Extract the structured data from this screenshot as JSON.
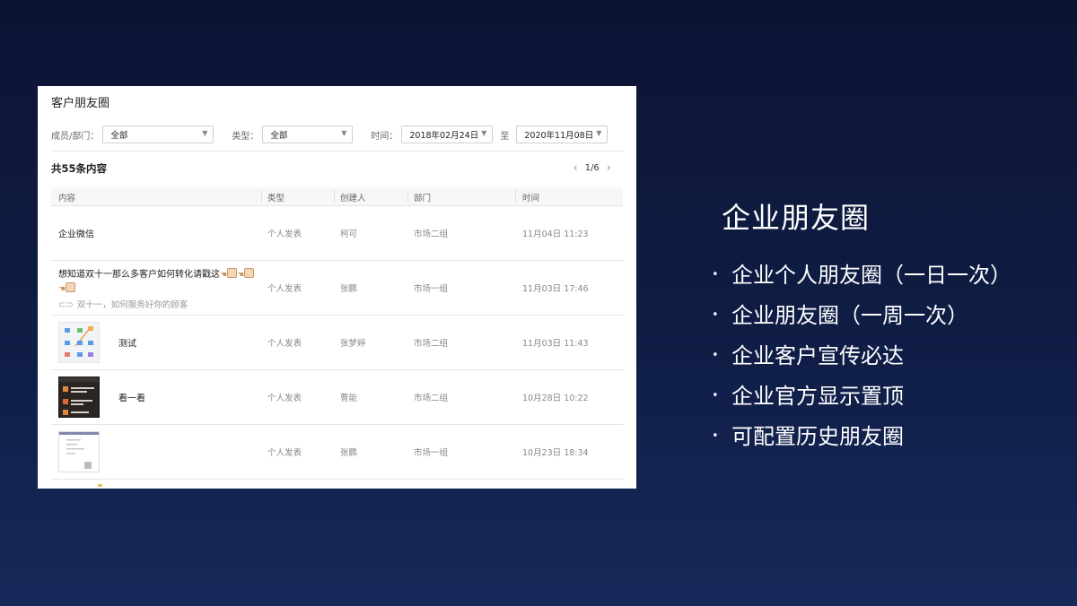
{
  "panel": {
    "title": "客户朋友圈",
    "filters": {
      "member_label": "成员/部门：",
      "member_value": "全部",
      "type_label": "类型：",
      "type_value": "全部",
      "time_label": "时间：",
      "start_date": "2018年02月24日",
      "to_label": "至",
      "end_date": "2020年11月08日"
    },
    "total": "共55条内容",
    "pager": "1/6",
    "columns": {
      "content": "内容",
      "type": "类型",
      "creator": "创建人",
      "dept": "部门",
      "time": "时间"
    },
    "rows": [
      {
        "content": "企业微信",
        "type": "个人发表",
        "creator": "柯可",
        "dept": "市场二组",
        "time": "11月04日  11:23"
      },
      {
        "content": "想知道双十一那么多客户如何转化请戳这",
        "link": "双十一，如何服务好你的顾客",
        "type": "个人发表",
        "creator": "张鹏",
        "dept": "市场一组",
        "time": "11月03日  17:46"
      },
      {
        "content": "测试",
        "type": "个人发表",
        "creator": "张梦婷",
        "dept": "市场二组",
        "time": "11月03日  11:43"
      },
      {
        "content": "看一看",
        "type": "个人发表",
        "creator": "曹能",
        "dept": "市场二组",
        "time": "10月28日  10:22"
      },
      {
        "content": "",
        "type": "个人发表",
        "creator": "张鹏",
        "dept": "市场一组",
        "time": "10月23日  18:34"
      }
    ]
  },
  "slide": {
    "title": "企业朋友圈",
    "bullets": [
      "企业个人朋友圈（一日一次）",
      "企业朋友圈（一周一次）",
      "企业客户宣传必达",
      "企业官方显示置顶",
      "可配置历史朋友圈"
    ]
  }
}
